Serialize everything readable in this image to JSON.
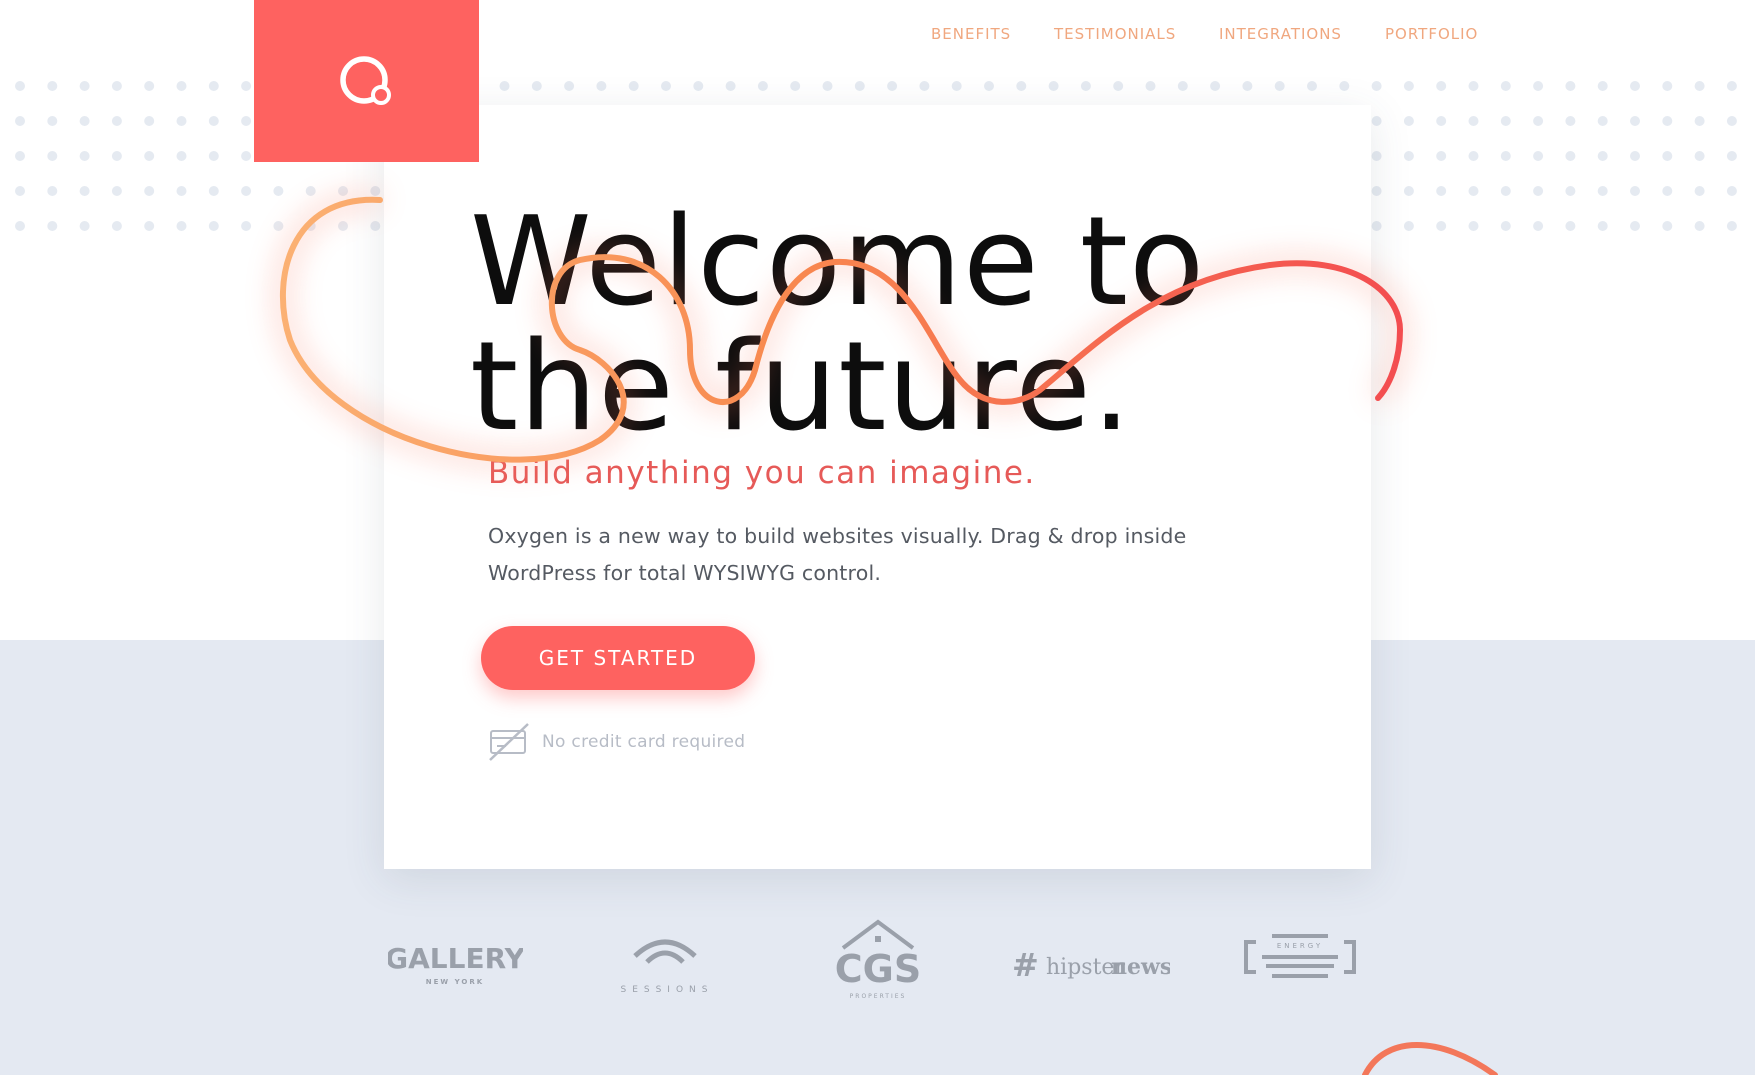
{
  "nav": {
    "items": [
      {
        "label": "BENEFITS"
      },
      {
        "label": "TESTIMONIALS"
      },
      {
        "label": "INTEGRATIONS"
      },
      {
        "label": "PORTFOLIO"
      }
    ]
  },
  "hero": {
    "headline_line1": "Welcome to",
    "headline_line2": "the future.",
    "subheadline": "Build anything you can imagine.",
    "description": "Oxygen is a new way to build websites visually. Drag & drop inside WordPress for total WYSIWYG control.",
    "cta_label": "GET STARTED",
    "no_credit_card": "No credit card required"
  },
  "clients": {
    "gallery": {
      "name": "GALLERY",
      "sub": "NEW YORK"
    },
    "sessions": {
      "name": "SESSIONS"
    },
    "cgs": {
      "name": "CGS",
      "sub": "PROPERTIES"
    },
    "hipster": {
      "hash": "#",
      "part1": "hipster",
      "part2": "news"
    },
    "energy": {
      "name": "ENERGY"
    }
  },
  "colors": {
    "brand": "#fe6260",
    "nav_link": "#f0a77f",
    "bottom_bg": "#e4e9f2",
    "squiggle_start": "#fbb173",
    "squiggle_end": "#f34d50"
  },
  "icons": {
    "logo": "oxygen-logo-icon",
    "no_credit_card": "no-credit-card-icon"
  }
}
